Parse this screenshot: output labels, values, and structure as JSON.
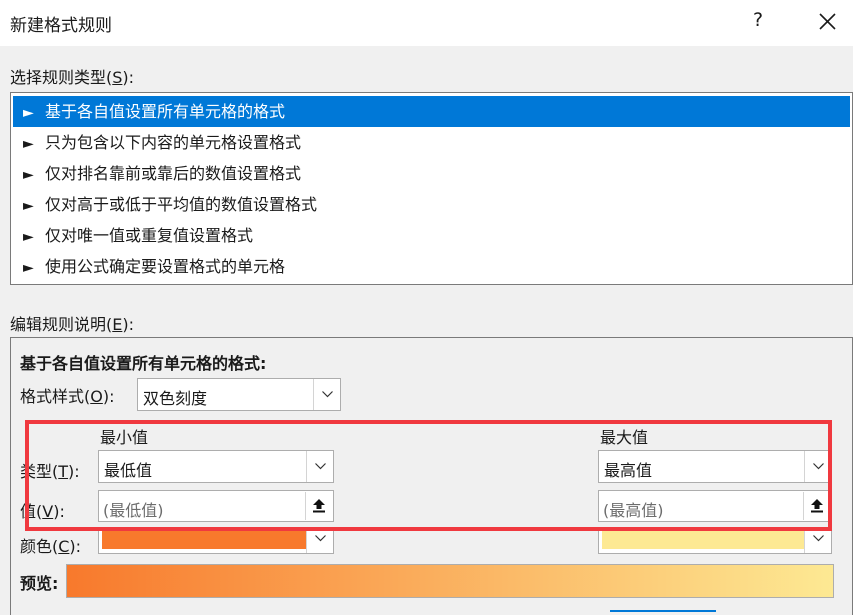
{
  "window": {
    "title": "新建格式规则",
    "help_label": "?"
  },
  "rule_type": {
    "label_prefix": "选择规则类型(",
    "label_key": "S",
    "label_suffix": "):",
    "items": [
      "基于各自值设置所有单元格的格式",
      "只为包含以下内容的单元格设置格式",
      "仅对排名靠前或靠后的数值设置格式",
      "仅对高于或低于平均值的数值设置格式",
      "仅对唯一值或重复值设置格式",
      "使用公式确定要设置格式的单元格"
    ],
    "selected_index": 0,
    "bullet": "►"
  },
  "rule_desc": {
    "label_prefix": "编辑规则说明(",
    "label_key": "E",
    "label_suffix": "):",
    "heading": "基于各自值设置所有单元格的格式:",
    "format_style_label_prefix": "格式样式(",
    "format_style_label_key": "O",
    "format_style_label_suffix": "):",
    "format_style_value": "双色刻度",
    "min_header": "最小值",
    "max_header": "最大值",
    "type_label_prefix": "类型(",
    "type_label_key": "T",
    "type_label_suffix": "):",
    "value_label_prefix": "值(",
    "value_label_key": "V",
    "value_label_suffix": "):",
    "color_label_prefix": "颜色(",
    "color_label_key": "C",
    "color_label_suffix": "):",
    "min_type": "最低值",
    "max_type": "最高值",
    "min_value_placeholder": "(最低值)",
    "max_value_placeholder": "(最高值)",
    "preview_label": "预览:"
  },
  "colors": {
    "selection": "#0078d7",
    "min_color": "#f8792c",
    "max_color": "#fde993",
    "highlight_border": "#f0393f"
  }
}
